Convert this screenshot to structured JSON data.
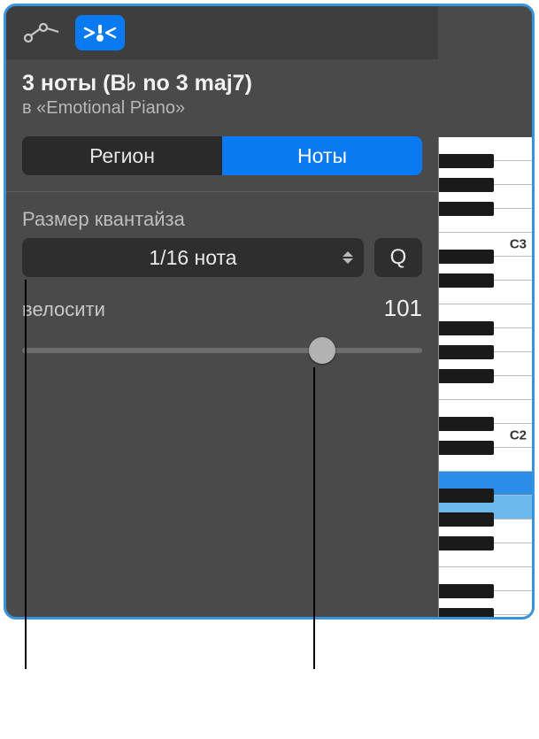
{
  "header": {
    "title": "3 ноты (B♭ no 3 maj7)",
    "subtitle": "в «Emotional Piano»"
  },
  "segmented": {
    "region": "Регион",
    "notes": "Ноты"
  },
  "quantize": {
    "section_label": "Размер квантайза",
    "select_value": "1/16 нота",
    "q_button": "Q"
  },
  "velocity": {
    "label": "велосити",
    "value": "101",
    "slider_percent": 75
  },
  "keyboard": {
    "c3_label": "C3",
    "c2_label": "C2"
  }
}
